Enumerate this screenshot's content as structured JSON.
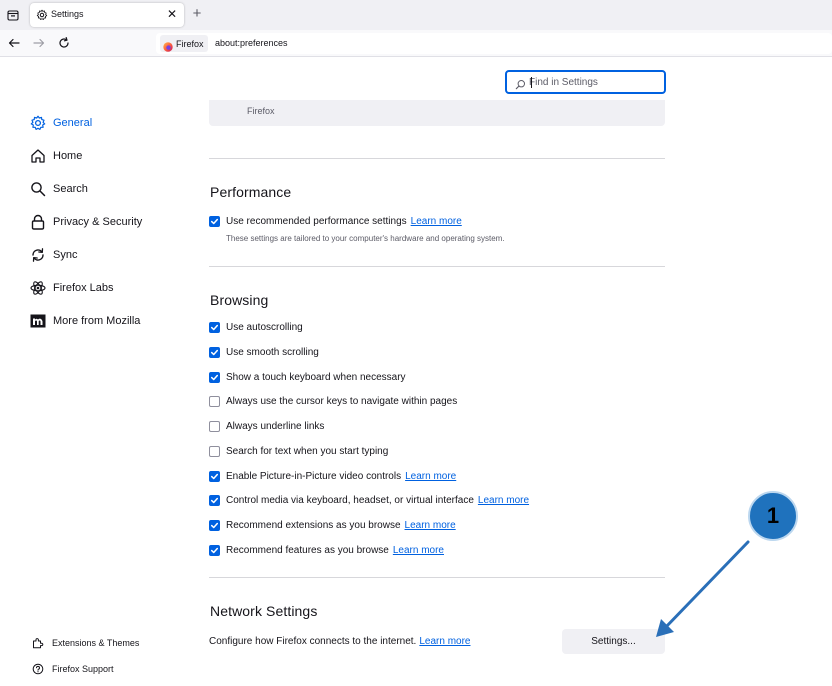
{
  "browser": {
    "tab_title": "Settings",
    "identity_label": "Firefox",
    "url": "about:preferences"
  },
  "search": {
    "placeholder": "Find in Settings"
  },
  "sidebar": {
    "items": [
      {
        "label": "General",
        "icon": "gear-icon",
        "selected": true
      },
      {
        "label": "Home",
        "icon": "home-icon"
      },
      {
        "label": "Search",
        "icon": "search-icon"
      },
      {
        "label": "Privacy & Security",
        "icon": "lock-icon"
      },
      {
        "label": "Sync",
        "icon": "sync-icon"
      },
      {
        "label": "Firefox Labs",
        "icon": "flask-icon"
      },
      {
        "label": "More from Mozilla",
        "icon": "mozilla-icon"
      }
    ],
    "footer": [
      {
        "label": "Extensions & Themes",
        "icon": "puzzle-icon"
      },
      {
        "label": "Firefox Support",
        "icon": "help-icon"
      }
    ]
  },
  "remnant_text": "Firefox",
  "performance": {
    "title": "Performance",
    "option_label": "Use recommended performance settings",
    "learn_more": "Learn more",
    "description": "These settings are tailored to your computer's hardware and operating system.",
    "checked": true
  },
  "browsing": {
    "title": "Browsing",
    "options": [
      {
        "label": "Use autoscrolling",
        "checked": true
      },
      {
        "label": "Use smooth scrolling",
        "checked": true
      },
      {
        "label": "Show a touch keyboard when necessary",
        "checked": true
      },
      {
        "label": "Always use the cursor keys to navigate within pages",
        "checked": false
      },
      {
        "label": "Always underline links",
        "checked": false
      },
      {
        "label": "Search for text when you start typing",
        "checked": false
      },
      {
        "label": "Enable Picture-in-Picture video controls",
        "checked": true,
        "link": "Learn more"
      },
      {
        "label": "Control media via keyboard, headset, or virtual interface",
        "checked": true,
        "link": "Learn more"
      },
      {
        "label": "Recommend extensions as you browse",
        "checked": true,
        "link": "Learn more"
      },
      {
        "label": "Recommend features as you browse",
        "checked": true,
        "link": "Learn more"
      }
    ]
  },
  "network": {
    "title": "Network Settings",
    "description": "Configure how Firefox connects to the internet.",
    "learn_more": "Learn more",
    "button_label": "Settings..."
  },
  "annotation": {
    "badge_number": "1",
    "color": "#1f72bd"
  },
  "colors": {
    "accent": "#0061e0",
    "text": "#15141a",
    "muted": "#5b5b66"
  }
}
